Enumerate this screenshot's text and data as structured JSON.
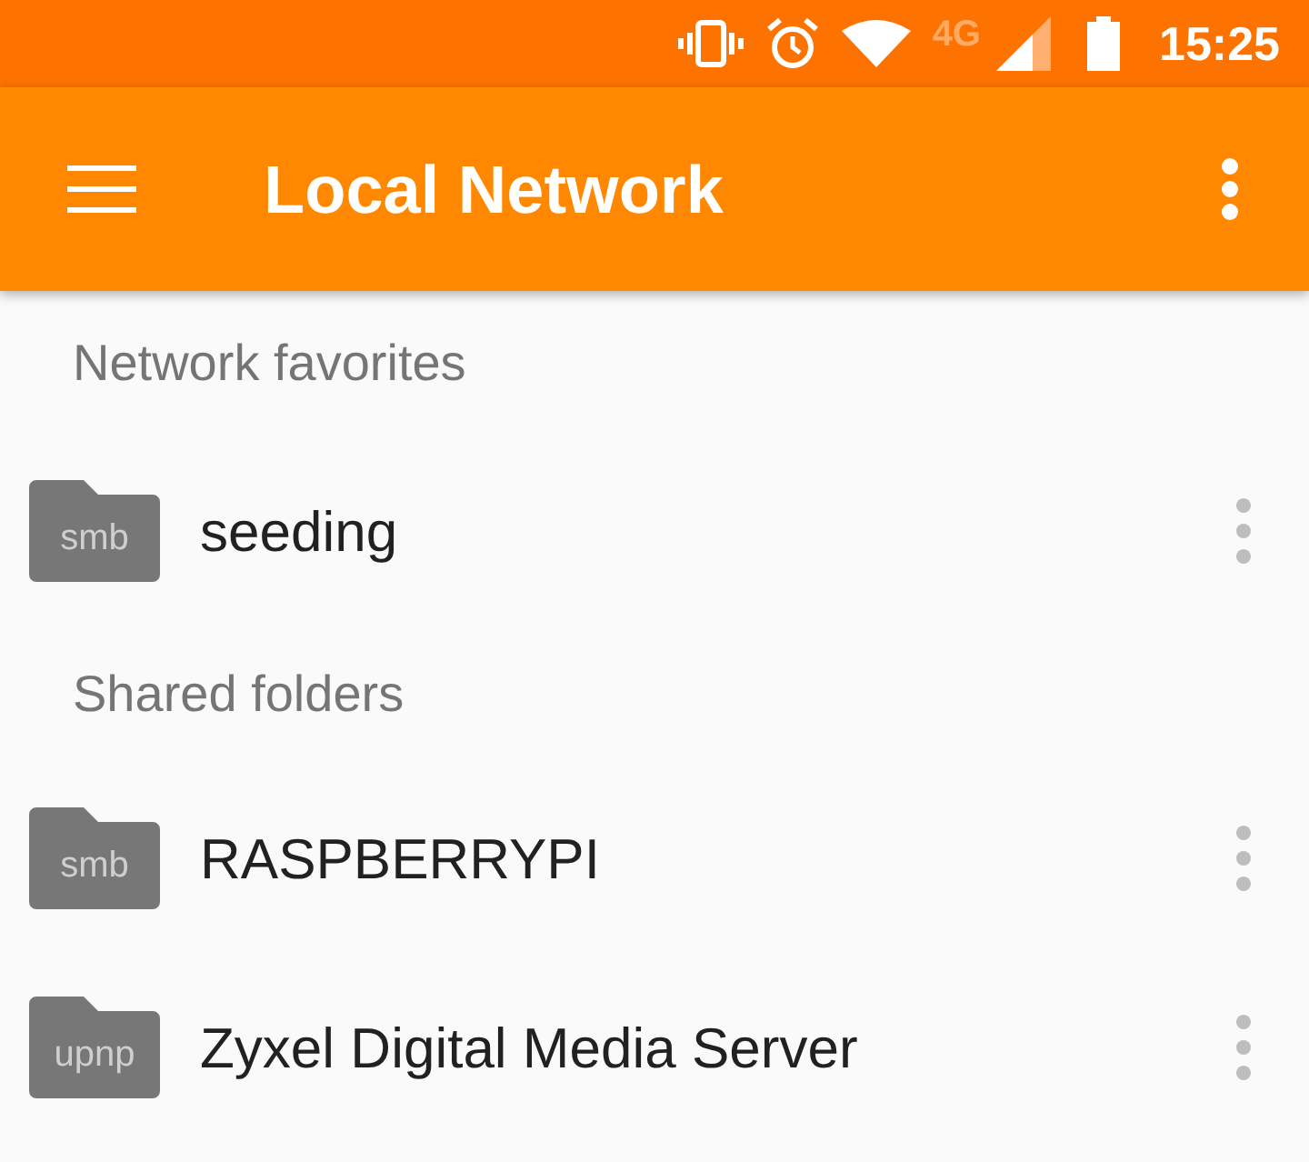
{
  "status_bar": {
    "network_type": "4G",
    "time": "15:25"
  },
  "app_bar": {
    "title": "Local Network"
  },
  "sections": [
    {
      "header": "Network favorites",
      "items": [
        {
          "name": "seeding",
          "protocol": "smb"
        }
      ]
    },
    {
      "header": "Shared folders",
      "items": [
        {
          "name": "RASPBERRYPI",
          "protocol": "smb"
        },
        {
          "name": "Zyxel Digital Media Server",
          "protocol": "upnp"
        }
      ]
    }
  ]
}
